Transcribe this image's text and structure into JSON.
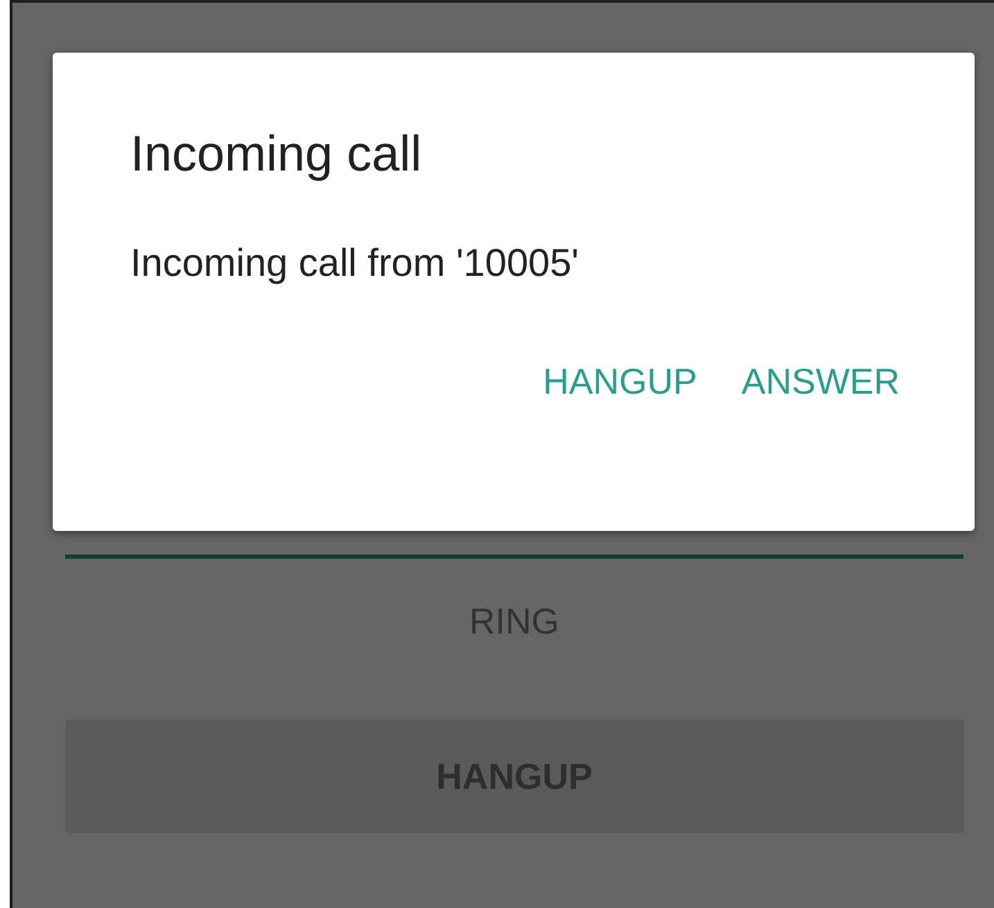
{
  "screen": {
    "buttons": [
      {
        "label": "RING",
        "kind": "flat"
      },
      {
        "label": "HANGUP",
        "kind": "raised"
      }
    ]
  },
  "dialog": {
    "title": "Incoming call",
    "message": "Incoming call from '10005'",
    "buttons": [
      {
        "label": "HANGUP"
      },
      {
        "label": "ANSWER"
      }
    ]
  }
}
